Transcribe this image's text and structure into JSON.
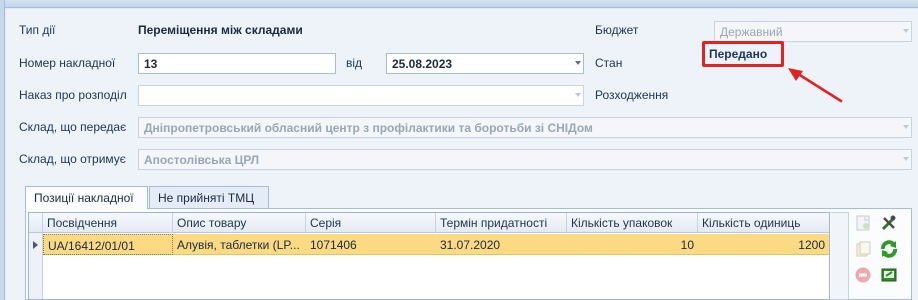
{
  "form": {
    "action_type_label": "Тип дії",
    "action_type_value": "Переміщення між складами",
    "invoice_number_label": "Номер накладної",
    "invoice_number_value": "13",
    "from_label": "від",
    "date_value": "25.08.2023",
    "order_label": "Наказ про розподіл",
    "order_value": "",
    "sender_label": "Склад, що передає",
    "sender_value": "Дніпропетровський обласний центр з профілактики та боротьби зі СНІДом",
    "receiver_label": "Склад, що отримує",
    "receiver_value": "Апостолівська ЦРЛ",
    "budget_label": "Бюджет",
    "budget_value": "Державний",
    "state_label": "Стан",
    "state_value": "Передано",
    "discrepancy_label": "Розходження"
  },
  "tabs": [
    {
      "label": "Позиції накладної",
      "active": true
    },
    {
      "label": "Не прийняті ТМЦ",
      "active": false
    }
  ],
  "grid": {
    "columns": [
      "Посвідчення",
      "Опис товару",
      "Серія",
      "Термін придатності",
      "Кількість упаковок",
      "Кількість одиниць"
    ],
    "rows": [
      [
        "UA/16412/01/01",
        "Алувія, таблетки  (LP...",
        "1071406",
        "31.07.2020",
        "10",
        "1200"
      ]
    ]
  },
  "colors": {
    "selected_row": "#fcd983",
    "highlight": "#e32222",
    "panel_bg": "#eef3fa"
  },
  "icons": [
    "new-document-icon",
    "tools-icon",
    "copy-icon",
    "refresh-icon",
    "delete-icon",
    "export-icon",
    "arrow-annotation-icon"
  ]
}
